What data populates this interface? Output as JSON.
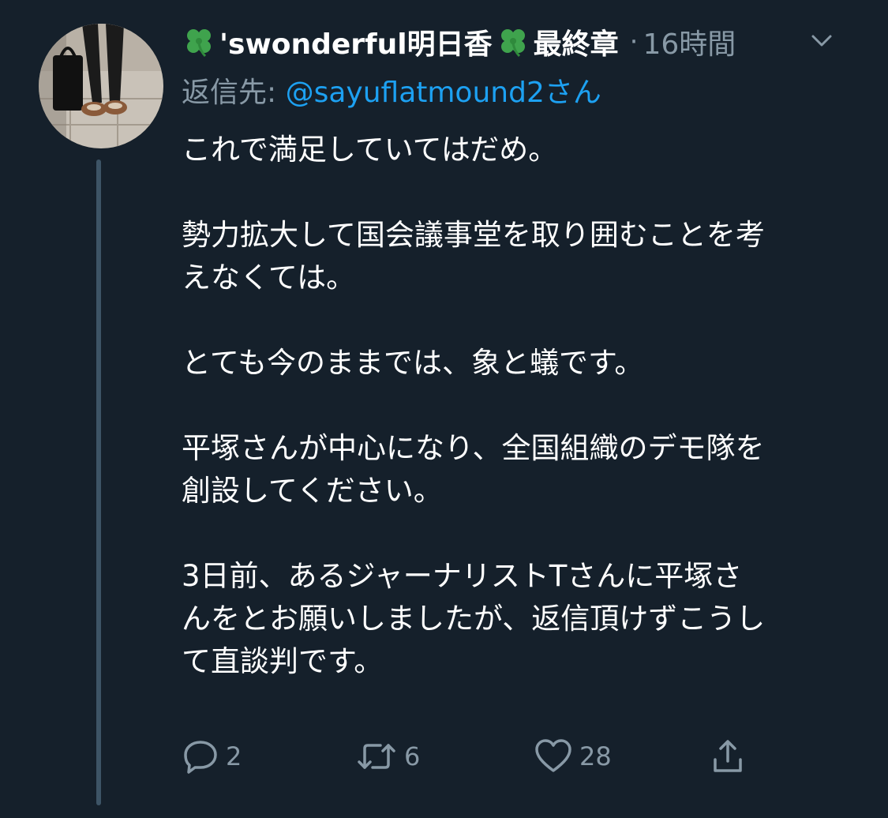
{
  "tweet": {
    "display_name": "'swonderful明日香",
    "display_suffix": "最終章",
    "separator": "·",
    "time": "16時間",
    "reply_prefix": "返信先: ",
    "reply_handle": "@sayuflatmound2さん",
    "lines": [
      "これで満足していてはだめ。",
      "",
      "勢力拡大して国会議事堂を取り囲むことを考",
      "えなくては。",
      "",
      "とても今のままでは、象と蟻です。",
      "",
      "平塚さんが中心になり、全国組織のデモ隊を",
      "創設してください。",
      "",
      "3日前、あるジャーナリストTさんに平塚さ",
      "んをとお願いしましたが、返信頂けずこうし",
      "て直談判です。"
    ],
    "actions": {
      "reply_count": "2",
      "retweet_count": "6",
      "like_count": "28"
    }
  },
  "colors": {
    "background": "#15202b",
    "text": "#ffffff",
    "secondary": "#8899a6",
    "link": "#1da1f2",
    "thread_line": "#3d5466",
    "clover": "#3fa34d"
  },
  "icons": {
    "name_prefix": "four-leaf-clover-icon",
    "name_suffix": "four-leaf-clover-icon",
    "more": "chevron-down-icon",
    "reply": "reply-bubble-icon",
    "retweet": "retweet-icon",
    "like": "heart-icon",
    "share": "share-icon"
  }
}
